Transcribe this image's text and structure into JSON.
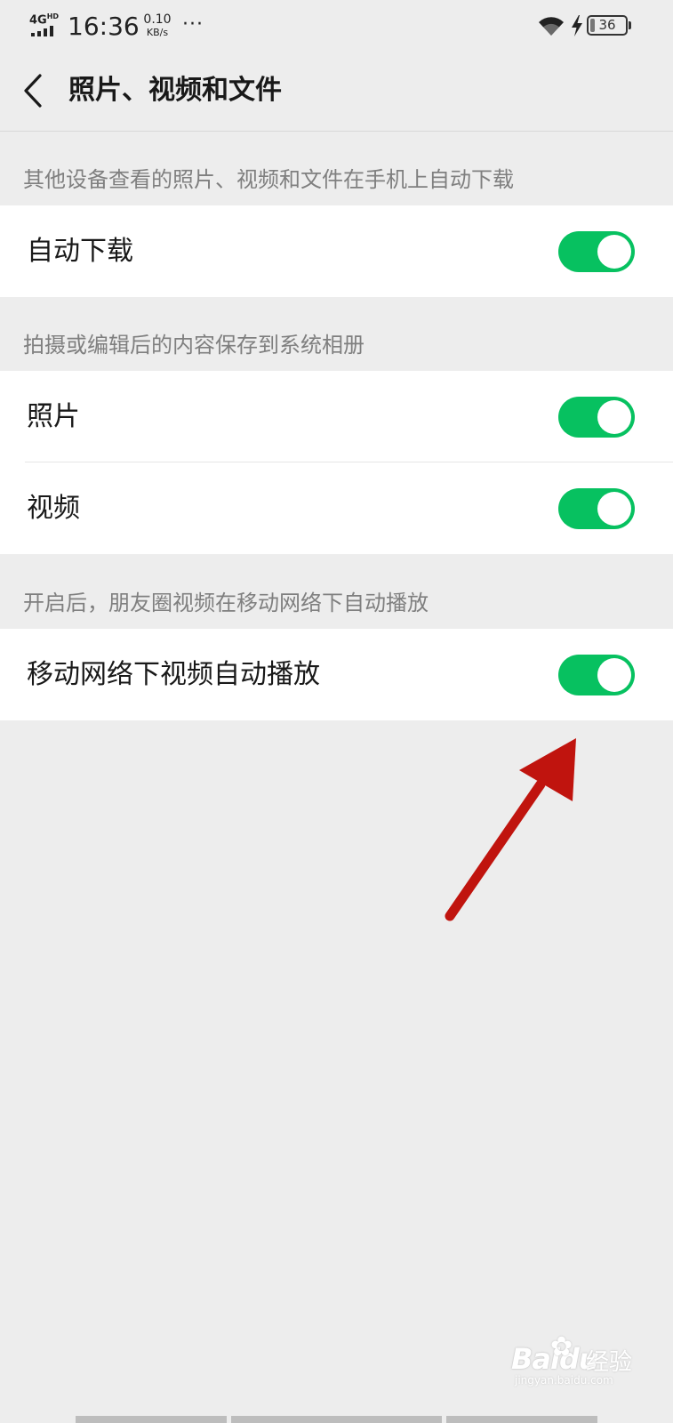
{
  "status_bar": {
    "network": "4G",
    "network_sup": "HD",
    "time": "16:36",
    "net_speed_value": "0.10",
    "net_speed_unit": "KB/s",
    "more": "···",
    "battery": "36"
  },
  "nav": {
    "title": "照片、视频和文件"
  },
  "sections": [
    {
      "header": "其他设备查看的照片、视频和文件在手机上自动下载",
      "items": [
        {
          "label": "自动下载",
          "on": true
        }
      ]
    },
    {
      "header": "拍摄或编辑后的内容保存到系统相册",
      "items": [
        {
          "label": "照片",
          "on": true
        },
        {
          "label": "视频",
          "on": true
        }
      ]
    },
    {
      "header": "开启后，朋友圈视频在移动网络下自动播放",
      "items": [
        {
          "label": "移动网络下视频自动播放",
          "on": true
        }
      ]
    }
  ],
  "colors": {
    "toggle_on": "#07c160",
    "background": "#ededed",
    "annotation_arrow": "#c0140e"
  },
  "watermark": {
    "logo": "Bai",
    "logo_tail": "du",
    "text": "经验",
    "url": "jingyan.baidu.com"
  }
}
